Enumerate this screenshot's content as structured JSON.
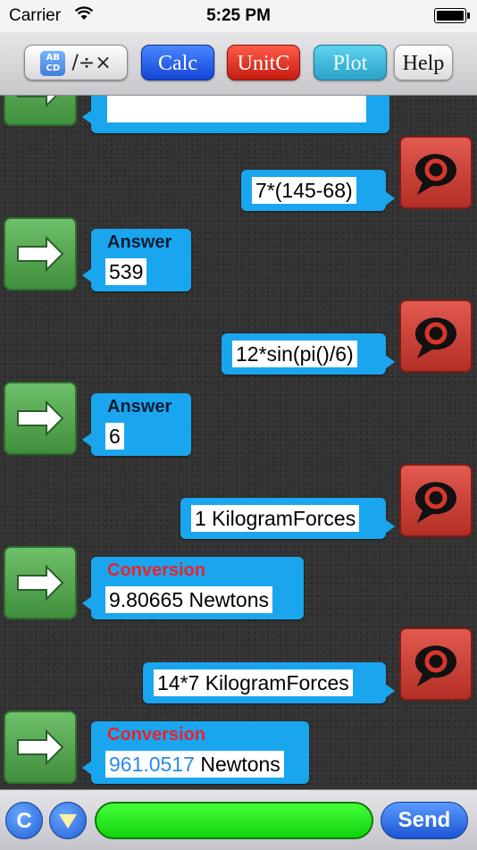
{
  "status_bar": {
    "carrier": "Carrier",
    "time": "5:25 PM"
  },
  "toolbar": {
    "keyboard_button_label": "/÷×",
    "keyboard_icon_text": "AB CD",
    "calc_label": "Calc",
    "unitc_label": "UnitC",
    "plot_label": "Plot",
    "help_label": "Help"
  },
  "messages": [
    {
      "type": "output",
      "text": "7*(145-68)"
    },
    {
      "type": "answer",
      "header": "Answer",
      "value": "539"
    },
    {
      "type": "output",
      "text": "12*sin(pi()/6)"
    },
    {
      "type": "answer",
      "header": "Answer",
      "value": "6"
    },
    {
      "type": "output",
      "text": "1 KilogramForces"
    },
    {
      "type": "conversion",
      "header": "Conversion",
      "value": "9.80665 Newtons"
    },
    {
      "type": "output",
      "text": "14*7 KilogramForces"
    },
    {
      "type": "conversion",
      "header": "Conversion",
      "value_number": "961.0517",
      "value_unit": " Newtons"
    }
  ],
  "bottom_bar": {
    "clear_label": "C",
    "input_value": "",
    "send_label": "Send"
  },
  "colors": {
    "bubble": "#1aa6ef",
    "conversion_header": "#e8232a",
    "answer_avatar": "#4fa84b",
    "query_avatar": "#c9382f",
    "input_field": "#22e11b"
  }
}
